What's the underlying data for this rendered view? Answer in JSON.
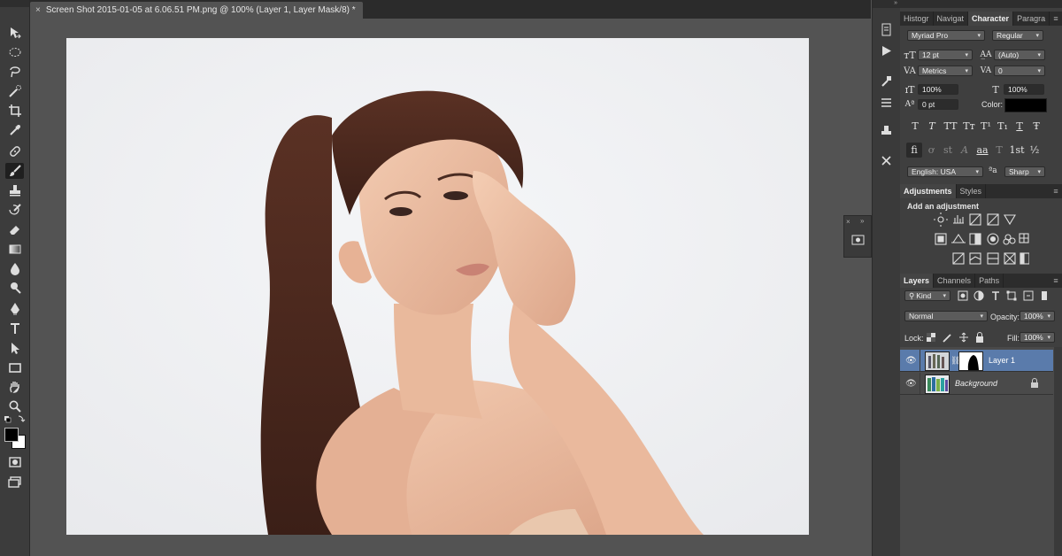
{
  "document": {
    "tab_title": "Screen Shot 2015-01-05 at 6.06.51 PM.png @ 100% (Layer 1, Layer Mask/8) *",
    "close_glyph": "×"
  },
  "toolbar": {
    "tools": [
      "move-tool",
      "rectangular-marquee-tool",
      "lasso-tool",
      "quick-selection-tool",
      "crop-tool",
      "eyedropper-tool",
      "spot-healing-brush-tool",
      "brush-tool",
      "clone-stamp-tool",
      "history-brush-tool",
      "eraser-tool",
      "gradient-tool",
      "blur-tool",
      "dodge-tool",
      "pen-tool",
      "type-tool",
      "path-selection-tool",
      "rectangle-tool",
      "hand-tool",
      "zoom-tool"
    ],
    "active_tool": "brush-tool",
    "foreground_color": "#000000",
    "background_color": "#ffffff"
  },
  "character_panel": {
    "tabs": [
      "Histogr",
      "Navigat",
      "Character",
      "Paragra"
    ],
    "active_tab": "Character",
    "font_family": "Myriad Pro",
    "font_style": "Regular",
    "font_size": "12 pt",
    "leading": "(Auto)",
    "kerning": "Metrics",
    "tracking": "0",
    "vertical_scale": "100%",
    "horizontal_scale": "100%",
    "baseline_shift": "0 pt",
    "color_label": "Color:",
    "color_value": "#000000",
    "style_buttons": [
      "T",
      "T",
      "TT",
      "Tт",
      "T¹",
      "T₁",
      "T",
      "Ŧ"
    ],
    "opentype_buttons": [
      "fi",
      "ơ",
      "st",
      "A",
      "aa",
      "T",
      "1st",
      "½"
    ],
    "language": "English: USA",
    "aa_label": "ªa",
    "antialias": "Sharp"
  },
  "adjustments_panel": {
    "tabs": [
      "Adjustments",
      "Styles"
    ],
    "active_tab": "Adjustments",
    "heading": "Add an adjustment"
  },
  "layers_panel": {
    "tabs": [
      "Layers",
      "Channels",
      "Paths"
    ],
    "active_tab": "Layers",
    "filter_kind": "Kind",
    "blend_mode": "Normal",
    "opacity_label": "Opacity:",
    "opacity": "100%",
    "lock_label": "Lock:",
    "fill_label": "Fill:",
    "fill": "100%",
    "layers": [
      {
        "name": "Layer 1",
        "selected": true,
        "has_mask": true
      },
      {
        "name": "Background",
        "selected": false,
        "locked": true
      }
    ]
  },
  "colors": {
    "selection_blue": "#5a7bab",
    "panel_bg": "#3f3f3f",
    "canvas_bg": "#535353"
  }
}
